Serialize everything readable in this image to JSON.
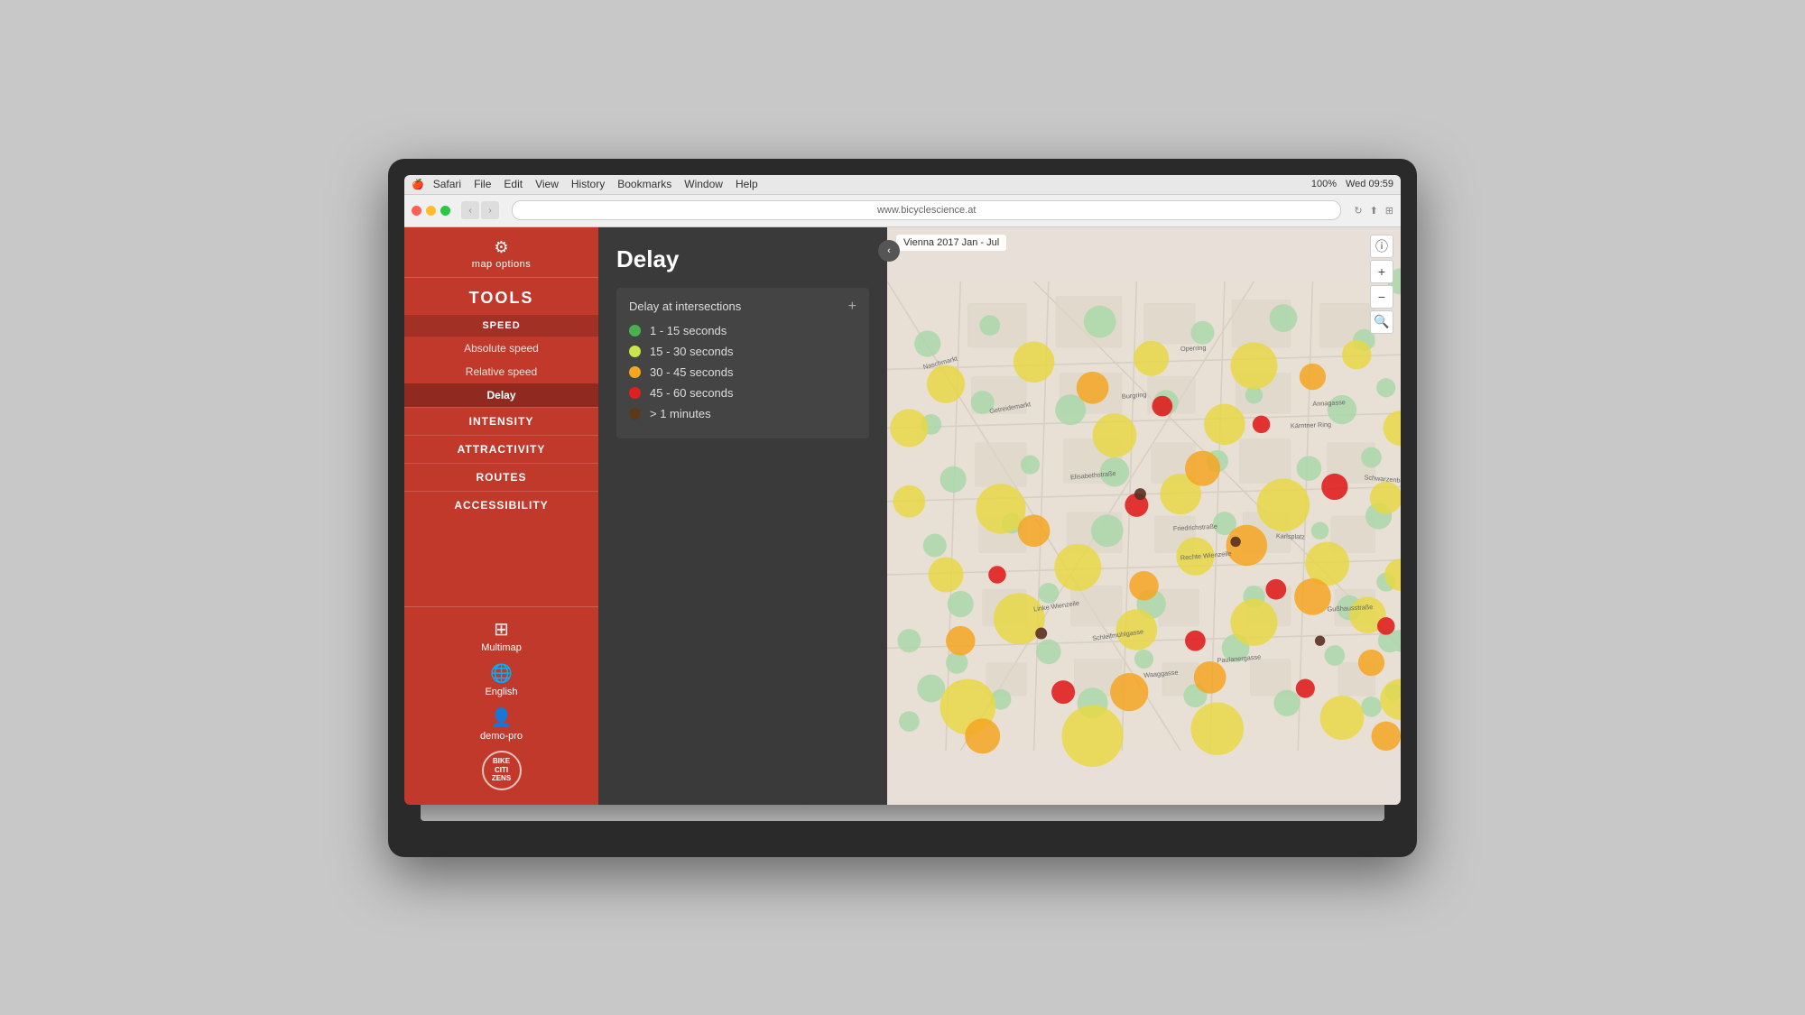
{
  "macos": {
    "apple": "🍎",
    "menu": [
      "Safari",
      "File",
      "Edit",
      "View",
      "History",
      "Bookmarks",
      "Window",
      "Help"
    ],
    "zoom": "100%",
    "time": "Wed 09:59",
    "address": "www.bicyclescience.at"
  },
  "browser": {
    "back": "‹",
    "forward": "›"
  },
  "sidebar": {
    "map_options_label": "map options",
    "tools_label": "TOOLS",
    "speed_header": "SPEED",
    "speed_items": [
      {
        "label": "Absolute speed",
        "active": false
      },
      {
        "label": "Relative speed",
        "active": false
      },
      {
        "label": "Delay",
        "active": true
      }
    ],
    "nav_items": [
      "INTENSITY",
      "ATTRACTIVITY",
      "ROUTES",
      "ACCESSIBILITY"
    ],
    "bottom_items": [
      {
        "icon": "⊞",
        "label": "Multimap"
      },
      {
        "icon": "🌐",
        "label": "English"
      },
      {
        "icon": "👤",
        "label": "demo-pro"
      }
    ],
    "logo_text": "BIKE\nCITI\nZENS"
  },
  "panel": {
    "title": "Delay",
    "toggle_icon": "‹",
    "legend_title": "Delay at intersections",
    "legend_add": "+",
    "legend_items": [
      {
        "color": "green",
        "label": "1 - 15 seconds"
      },
      {
        "color": "yellow-light",
        "label": "15 - 30 seconds"
      },
      {
        "color": "orange",
        "label": "30 - 45 seconds"
      },
      {
        "color": "red",
        "label": "45 - 60 seconds"
      },
      {
        "color": "dark",
        "label": "> 1 minutes"
      }
    ]
  },
  "map": {
    "label": "Vienna 2017 Jan - Jul",
    "zoom_in": "+",
    "zoom_out": "−",
    "search_icon": "🔍",
    "info_icon": "ⓘ"
  }
}
